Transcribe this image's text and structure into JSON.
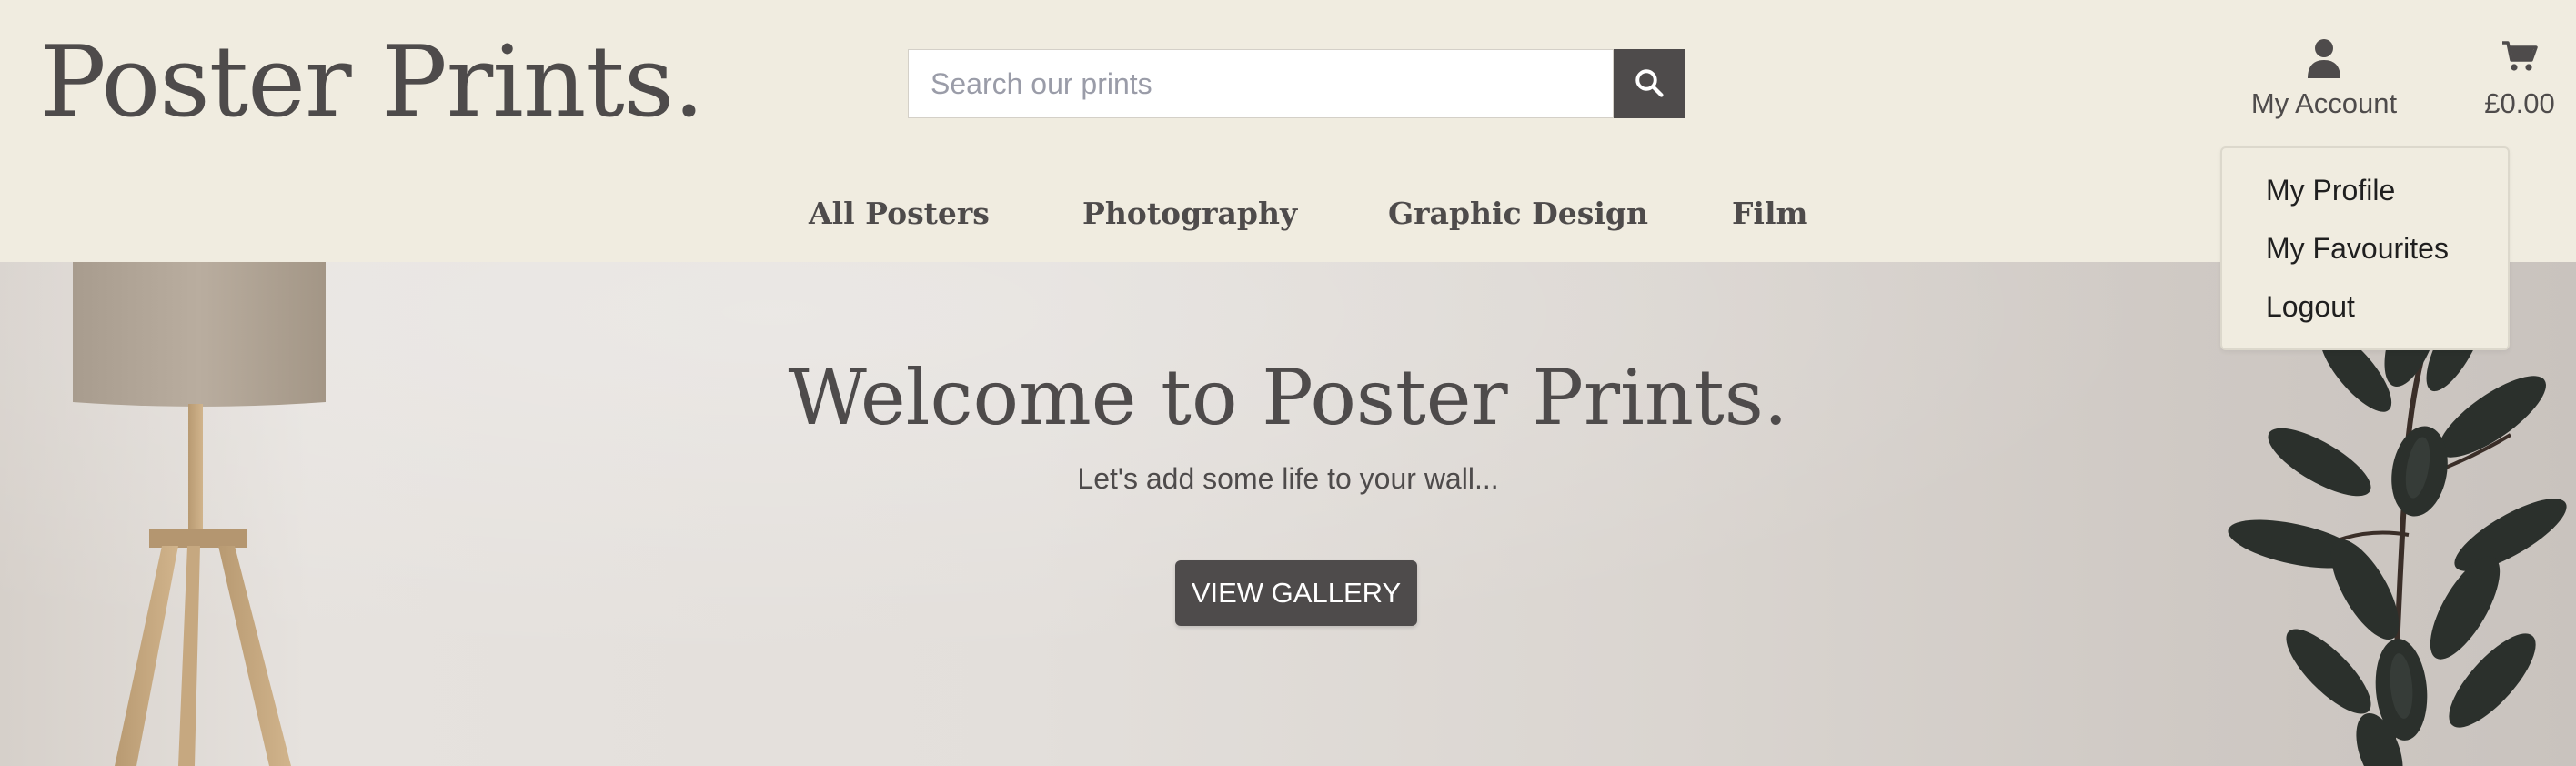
{
  "header": {
    "logo": "Poster Prints.",
    "search": {
      "placeholder": "Search our prints",
      "value": "",
      "button_icon": "search-icon"
    },
    "account": {
      "label": "My Account",
      "icon": "user-icon"
    },
    "cart": {
      "total": "£0.00",
      "icon": "cart-icon"
    }
  },
  "account_dropdown": {
    "items": [
      {
        "label": "My Profile"
      },
      {
        "label": "My Favourites"
      },
      {
        "label": "Logout"
      }
    ]
  },
  "nav": {
    "items": [
      {
        "label": "All Posters"
      },
      {
        "label": "Photography"
      },
      {
        "label": "Graphic Design"
      },
      {
        "label": "Film"
      }
    ]
  },
  "hero": {
    "title": "Welcome to Poster Prints.",
    "subtitle": "Let's add some life to your wall...",
    "button_label": "VIEW GALLERY"
  },
  "colors": {
    "header_bg": "#f0ece0",
    "primary_dark": "#4e4b4b",
    "button_text": "#ffffff"
  }
}
